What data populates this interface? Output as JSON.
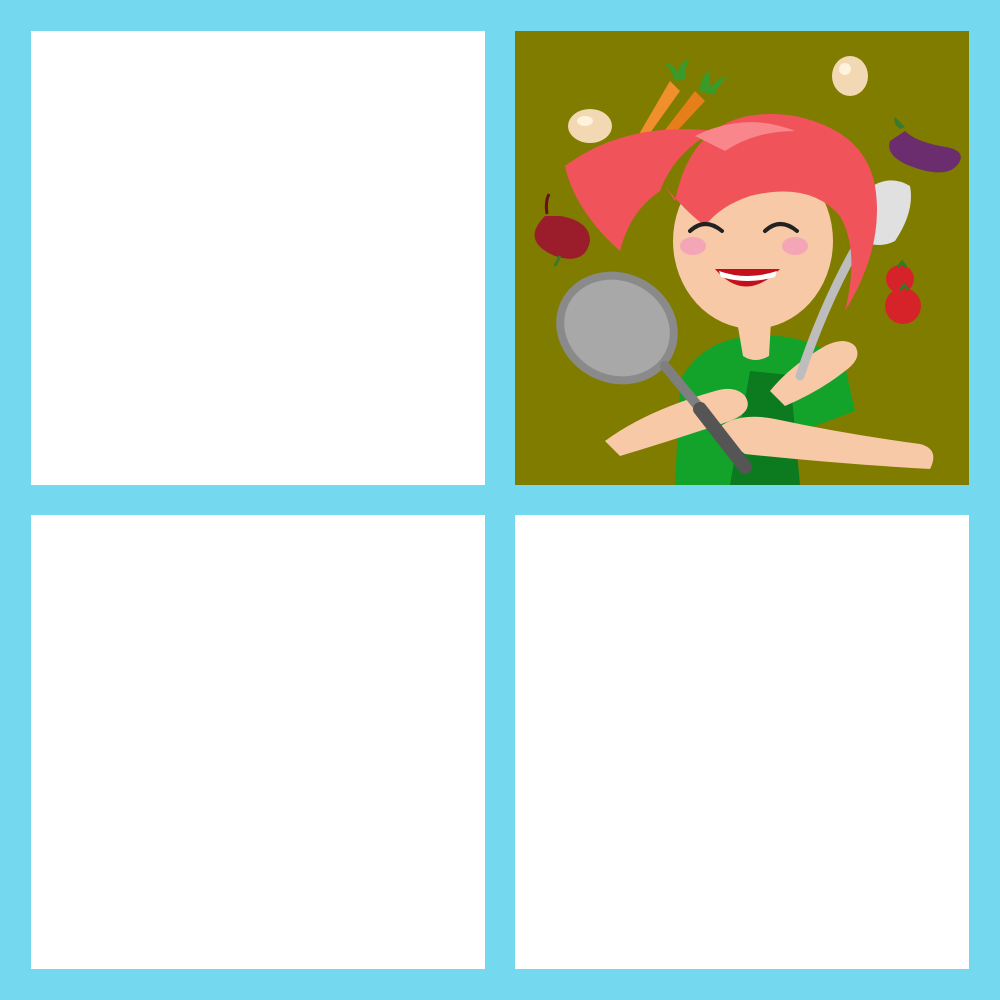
{
  "game": {
    "type": "memory-card-grid",
    "rows": 2,
    "columns": 2,
    "colors": {
      "board_background": "#74d9ee",
      "hidden_card": "#ffffff",
      "revealed_card_background": "#807c00"
    },
    "cards": [
      {
        "state": "hidden"
      },
      {
        "state": "revealed",
        "image": "cartoon-chef-girl-with-frying-pan-and-spatula"
      },
      {
        "state": "hidden"
      },
      {
        "state": "hidden"
      }
    ]
  }
}
